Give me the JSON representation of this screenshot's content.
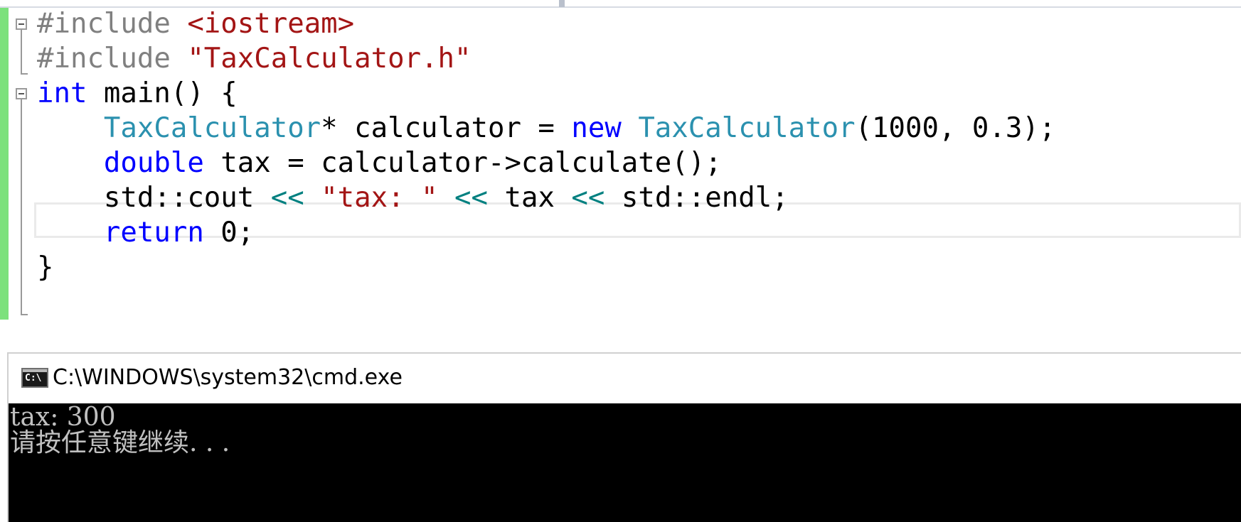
{
  "editor": {
    "lines": [
      {
        "tokens": [
          {
            "t": "#include ",
            "c": "pre"
          },
          {
            "t": "<iostream>",
            "c": "str"
          }
        ]
      },
      {
        "tokens": [
          {
            "t": "#include ",
            "c": "pre"
          },
          {
            "t": "\"TaxCalculator.h\"",
            "c": "str"
          }
        ]
      },
      {
        "tokens": [
          {
            "t": "int",
            "c": "kw"
          },
          {
            "t": " main() {",
            "c": "pl"
          }
        ]
      },
      {
        "tokens": [
          {
            "t": "    ",
            "c": "pl"
          },
          {
            "t": "TaxCalculator",
            "c": "type"
          },
          {
            "t": "* calculator = ",
            "c": "pl"
          },
          {
            "t": "new",
            "c": "kw"
          },
          {
            "t": " ",
            "c": "pl"
          },
          {
            "t": "TaxCalculator",
            "c": "type"
          },
          {
            "t": "(1000, 0.3);",
            "c": "pl"
          }
        ]
      },
      {
        "tokens": [
          {
            "t": "    ",
            "c": "pl"
          },
          {
            "t": "double",
            "c": "kw"
          },
          {
            "t": " tax = calculator->calculate();",
            "c": "pl"
          }
        ]
      },
      {
        "tokens": [
          {
            "t": "    std::cout ",
            "c": "pl"
          },
          {
            "t": "<<",
            "c": "op"
          },
          {
            "t": " ",
            "c": "pl"
          },
          {
            "t": "\"tax: \"",
            "c": "str"
          },
          {
            "t": " ",
            "c": "pl"
          },
          {
            "t": "<<",
            "c": "op"
          },
          {
            "t": " tax ",
            "c": "pl"
          },
          {
            "t": "<<",
            "c": "op"
          },
          {
            "t": " std::endl;",
            "c": "pl"
          }
        ]
      },
      {
        "tokens": [
          {
            "t": "    ",
            "c": "pl"
          },
          {
            "t": "return",
            "c": "kw"
          },
          {
            "t": " 0;",
            "c": "pl"
          }
        ]
      },
      {
        "tokens": [
          {
            "t": "}",
            "c": "pl"
          }
        ]
      }
    ]
  },
  "console": {
    "title": "C:\\WINDOWS\\system32\\cmd.exe",
    "icon": "cmd-icon",
    "icon_label": "C:\\",
    "output": [
      "tax: 300",
      "请按任意键继续. . ."
    ]
  },
  "colors": {
    "preprocessor": "#808080",
    "string": "#a31515",
    "keyword": "#0000ff",
    "type": "#2b91af",
    "operator": "#008080",
    "change_bar": "#7ce17c",
    "console_bg": "#000000",
    "console_text": "#c0c0c0"
  }
}
